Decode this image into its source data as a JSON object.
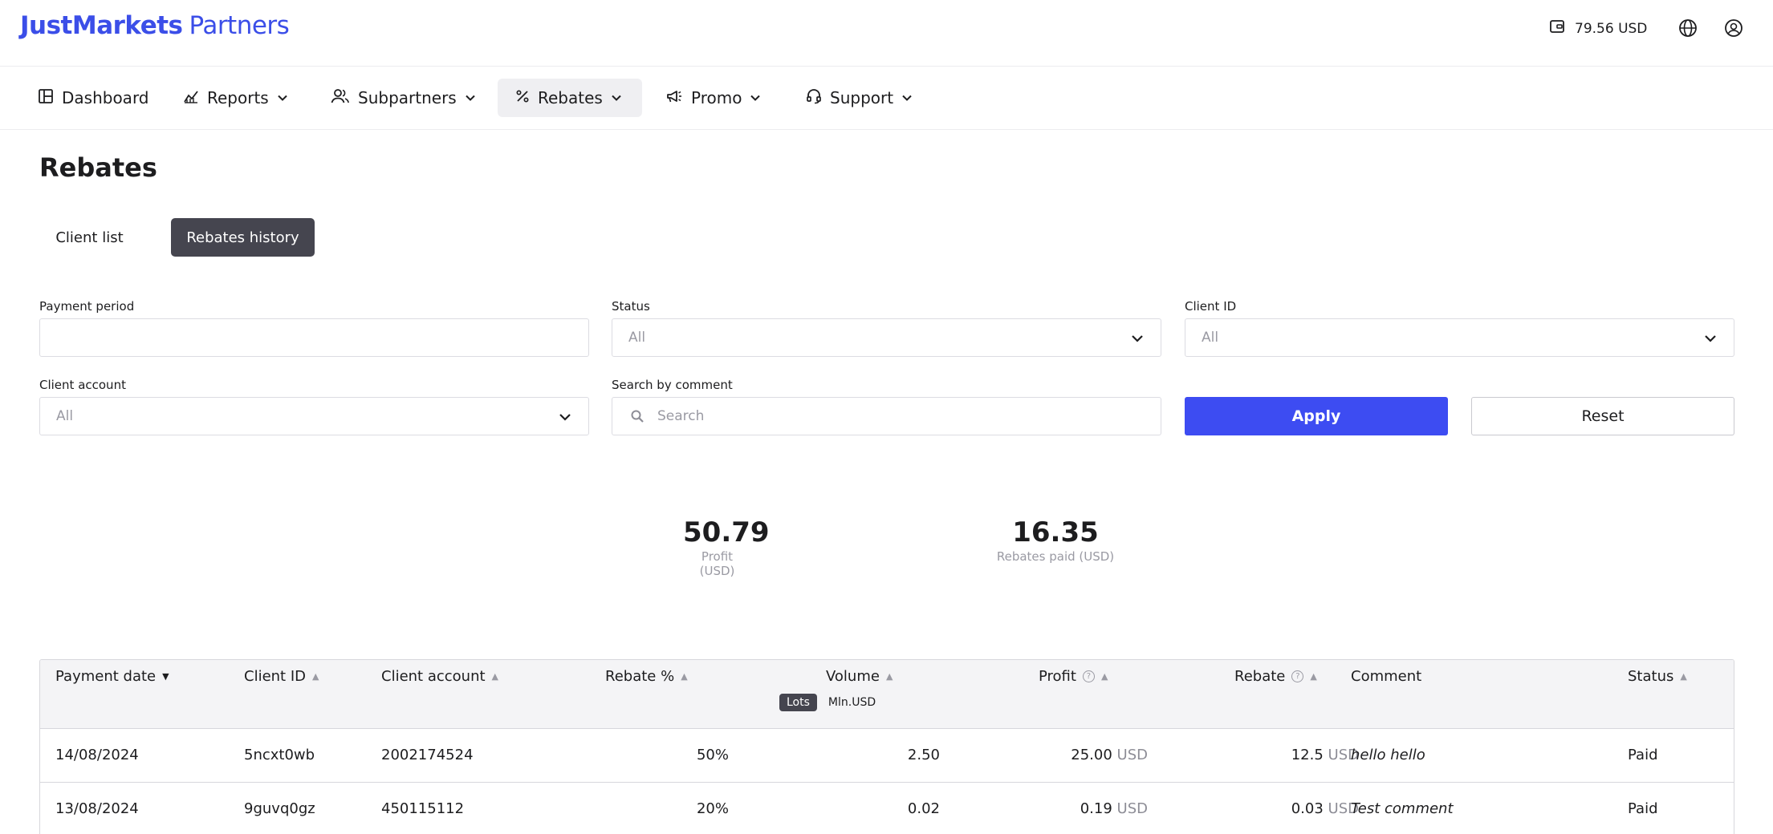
{
  "header": {
    "brand": "JustMarkets",
    "brand_suffix": "Partners",
    "balance": "79.56 USD",
    "icons": [
      "wallet-icon",
      "globe-icon",
      "user-icon"
    ]
  },
  "nav": {
    "items": [
      {
        "label": "Dashboard",
        "icon": "dashboard-icon"
      },
      {
        "label": "Reports",
        "icon": "chart-icon"
      },
      {
        "label": "Subpartners",
        "icon": "users-icon"
      },
      {
        "label": "Rebates",
        "icon": "percent-icon",
        "active": true
      },
      {
        "label": "Promo",
        "icon": "megaphone-icon"
      },
      {
        "label": "Support",
        "icon": "headset-icon"
      }
    ]
  },
  "page": {
    "title": "Rebates",
    "tabs": [
      "Client list",
      "Rebates history"
    ],
    "active_tab": "Rebates history"
  },
  "filters": {
    "payment_period": {
      "label": "Payment period",
      "value": ""
    },
    "status": {
      "label": "Status",
      "value": "All"
    },
    "client_id": {
      "label": "Client ID",
      "value": "All"
    },
    "client_account": {
      "label": "Client account",
      "value": "All"
    },
    "search_comment": {
      "label": "Search by comment",
      "placeholder": "Search"
    },
    "apply_label": "Apply",
    "reset_label": "Reset"
  },
  "summary": {
    "profit": {
      "value": "50.79",
      "label": "Profit (USD)"
    },
    "rebates_paid": {
      "value": "16.35",
      "label": "Rebates paid (USD)"
    }
  },
  "table": {
    "columns": [
      "Payment date",
      "Client ID",
      "Client account",
      "Rebate %",
      "Volume",
      "Profit",
      "Rebate",
      "Comment",
      "Status"
    ],
    "volume_units": [
      "Lots",
      "Mln.USD"
    ],
    "active_unit": "Lots",
    "currency": "USD",
    "rows": [
      {
        "payment_date": "14/08/2024",
        "client_id": "5ncxt0wb",
        "client_account": "2002174524",
        "rebate_pct": "50%",
        "volume": "2.50",
        "profit": "25.00",
        "rebate": "12.5",
        "comment": "hello hello",
        "status": "Paid"
      },
      {
        "payment_date": "13/08/2024",
        "client_id": "9guvq0gz",
        "client_account": "450115112",
        "rebate_pct": "20%",
        "volume": "0.02",
        "profit": "0.19",
        "rebate": "0.03",
        "comment": "Test comment",
        "status": "Paid"
      }
    ]
  },
  "colors": {
    "accent": "#3d4cf2",
    "brand": "#3b4ee8",
    "tab_active": "#45454f"
  }
}
